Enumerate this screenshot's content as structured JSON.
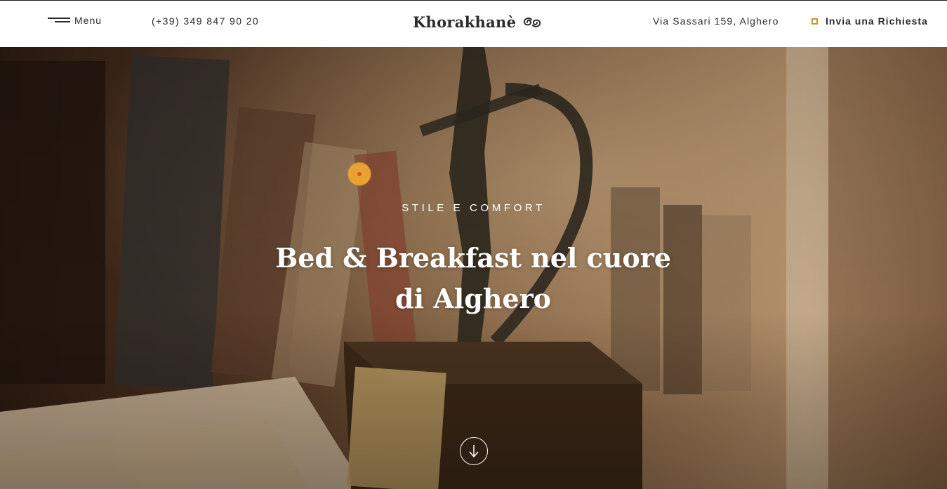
{
  "header": {
    "menu_label": "Menu",
    "phone": "(+39) 349 847 90 20",
    "logo_text": "Khorakhanè",
    "logo_icon": "double-spiral-icon",
    "address": "Via Sassari 159, Alghero",
    "request_label": "Invia una Richiesta"
  },
  "hero": {
    "subtitle": "STILE E COMFORT",
    "title": "Bed & Breakfast nel cuore di Alghero",
    "scroll_icon": "arrow-down-icon",
    "image_description": "photo of a bronze nuraghic archer statuette on wooden base with books in background"
  },
  "colors": {
    "accent_gold": "#c49a2d",
    "dot_orange": "#e8a232",
    "dot_center": "#d9542a",
    "text_dark": "#2b2b2b",
    "hero_text": "#ffffff"
  }
}
